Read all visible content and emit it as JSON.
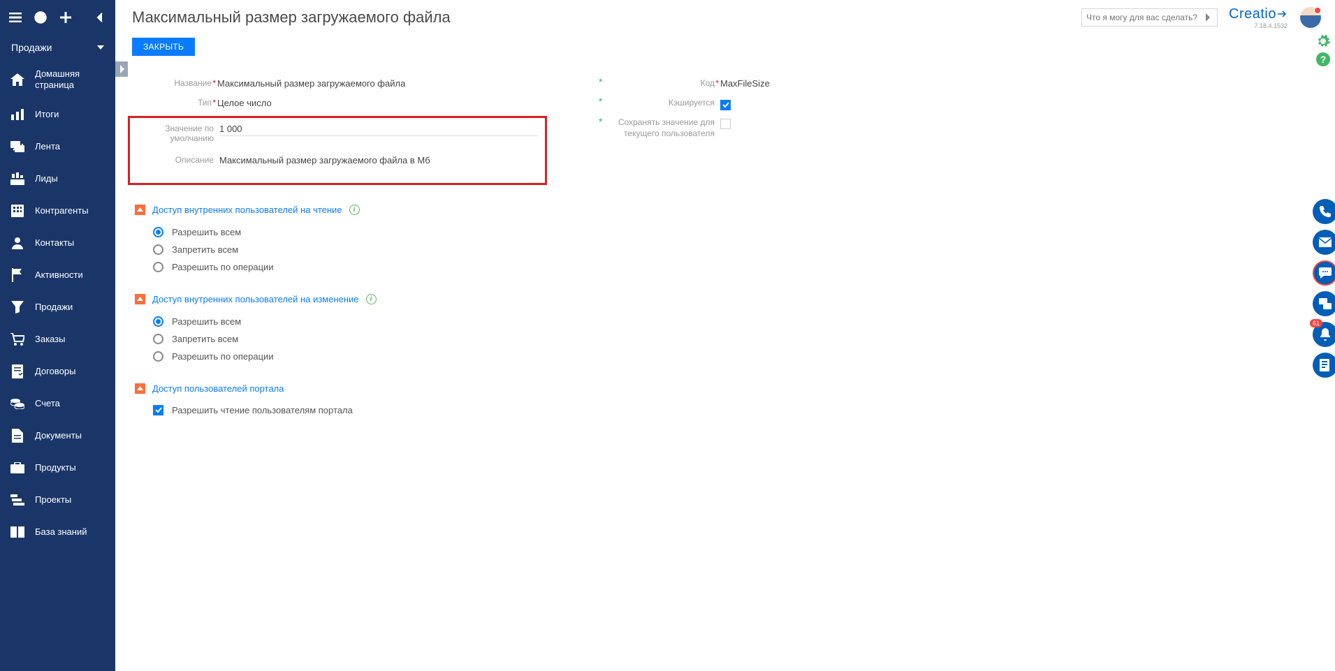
{
  "sidebar": {
    "section_header": "Продажи",
    "items": [
      {
        "label": "Домашняя\nстраница",
        "icon": "home"
      },
      {
        "label": "Итоги",
        "icon": "chart"
      },
      {
        "label": "Лента",
        "icon": "feed"
      },
      {
        "label": "Лиды",
        "icon": "leads"
      },
      {
        "label": "Контрагенты",
        "icon": "building"
      },
      {
        "label": "Контакты",
        "icon": "person"
      },
      {
        "label": "Активности",
        "icon": "flag"
      },
      {
        "label": "Продажи",
        "icon": "funnel"
      },
      {
        "label": "Заказы",
        "icon": "cart"
      },
      {
        "label": "Договоры",
        "icon": "contract"
      },
      {
        "label": "Счета",
        "icon": "coins"
      },
      {
        "label": "Документы",
        "icon": "doc"
      },
      {
        "label": "Продукты",
        "icon": "briefcase"
      },
      {
        "label": "Проекты",
        "icon": "project"
      },
      {
        "label": "База знаний",
        "icon": "book"
      }
    ]
  },
  "topbar": {
    "title": "Максимальный размер загружаемого файла",
    "search_placeholder": "Что я могу для вас сделать?",
    "brand": "Creatio",
    "version": "7.18.4.1532"
  },
  "actions": {
    "close": "ЗАКРЫТЬ"
  },
  "form": {
    "left": {
      "name_label": "Название",
      "name_value": "Максимальный размер загружаемого файла",
      "type_label": "Тип",
      "type_value": "Целое число",
      "default_label": "Значение по умолчанию",
      "default_value": "1 000",
      "desc_label": "Описание",
      "desc_value": "Максимальный размер загружаемого файла в Мб"
    },
    "right": {
      "code_label": "Код",
      "code_value": "MaxFileSize",
      "cache_label": "Кэшируется",
      "save_label": "Сохранять значение для текущего пользователя"
    }
  },
  "sections": {
    "read": {
      "title": "Доступ внутренних пользователей на чтение",
      "options": [
        "Разрешить всем",
        "Запретить всем",
        "Разрешить по операции"
      ]
    },
    "write": {
      "title": "Доступ внутренних пользователей на изменение",
      "options": [
        "Разрешить всем",
        "Запретить всем",
        "Разрешить по операции"
      ]
    },
    "portal": {
      "title": "Доступ пользователей портала",
      "check_label": "Разрешить чтение пользователям портала"
    }
  },
  "right_panel": {
    "notification_badge": "61"
  }
}
